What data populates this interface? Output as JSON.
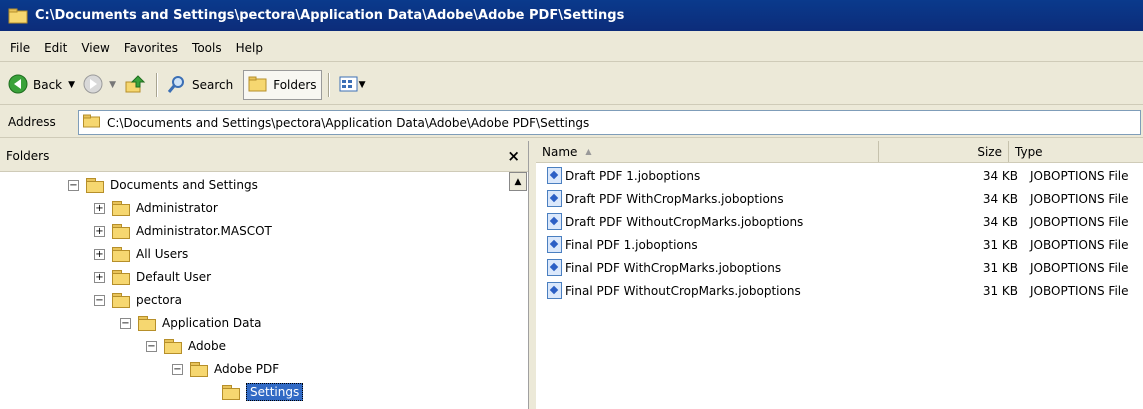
{
  "window": {
    "title": "C:\\Documents and Settings\\pectora\\Application Data\\Adobe\\Adobe PDF\\Settings"
  },
  "menu": [
    "File",
    "Edit",
    "View",
    "Favorites",
    "Tools",
    "Help"
  ],
  "toolbar": {
    "back_label": "Back",
    "search_label": "Search",
    "folders_label": "Folders"
  },
  "address": {
    "label": "Address",
    "value": "C:\\Documents and Settings\\pectora\\Application Data\\Adobe\\Adobe PDF\\Settings"
  },
  "folders_pane": {
    "title": "Folders",
    "close_glyph": "×",
    "tree": [
      {
        "label": "Documents and Settings",
        "toggle": "−"
      },
      {
        "label": "Administrator",
        "toggle": "+"
      },
      {
        "label": "Administrator.MASCOT",
        "toggle": "+"
      },
      {
        "label": "All Users",
        "toggle": "+"
      },
      {
        "label": "Default User",
        "toggle": "+"
      },
      {
        "label": "pectora",
        "toggle": "−"
      },
      {
        "label": "Application Data",
        "toggle": "−"
      },
      {
        "label": "Adobe",
        "toggle": "−"
      },
      {
        "label": "Adobe PDF",
        "toggle": "−"
      },
      {
        "label": "Settings",
        "toggle": "",
        "selected": true
      }
    ]
  },
  "files": {
    "columns": {
      "name": "Name",
      "size": "Size",
      "type": "Type",
      "sort_indicator": "▲"
    },
    "rows": [
      {
        "name": "Draft PDF 1.joboptions",
        "size": "34 KB",
        "type": "JOBOPTIONS File"
      },
      {
        "name": "Draft PDF WithCropMarks.joboptions",
        "size": "34 KB",
        "type": "JOBOPTIONS File"
      },
      {
        "name": "Draft PDF WithoutCropMarks.joboptions",
        "size": "34 KB",
        "type": "JOBOPTIONS File"
      },
      {
        "name": "Final PDF 1.joboptions",
        "size": "31 KB",
        "type": "JOBOPTIONS File"
      },
      {
        "name": "Final PDF WithCropMarks.joboptions",
        "size": "31 KB",
        "type": "JOBOPTIONS File"
      },
      {
        "name": "Final PDF WithoutCropMarks.joboptions",
        "size": "31 KB",
        "type": "JOBOPTIONS File"
      }
    ]
  },
  "colors": {
    "title_bar": "#0a3a8c",
    "selection": "#316ac5"
  }
}
